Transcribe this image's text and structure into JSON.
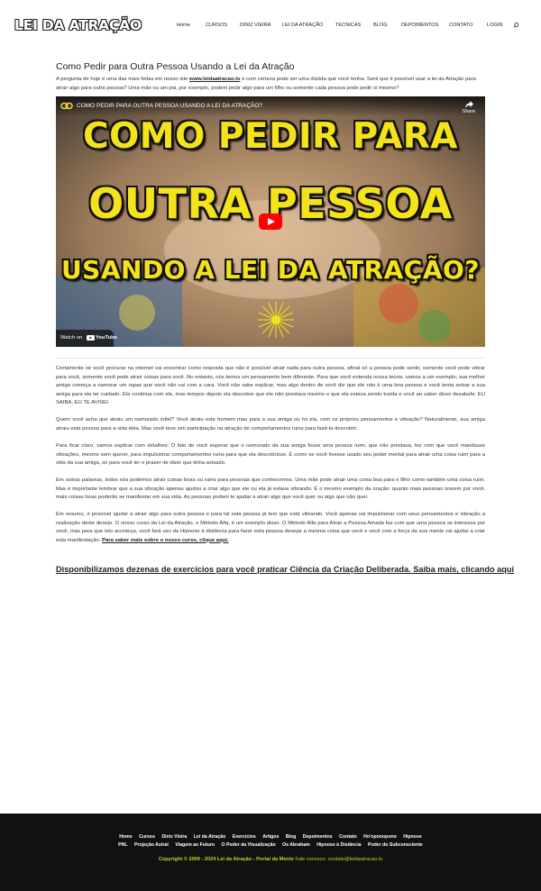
{
  "header": {
    "logo": "LEI DA ATRAÇÃO",
    "nav": [
      "Home",
      "CURSOS",
      "DINIZ VIEIRA",
      "LEI DA ATRAÇÃO",
      "TECNICAS",
      "BLOG",
      "DEPOIMENTOS",
      "CONTATO",
      "LOGIN"
    ],
    "search_icon": "search-icon"
  },
  "article": {
    "title": "Como Pedir para Outra Pessoa Usando a Lei da Atração",
    "intro_before": "A pergunta de hoje é uma das mais feitas em nosso site ",
    "intro_link": "www.leidaatracao.tv",
    "intro_after": " e com certeza pode ser uma dúvida que você tenha: Será que é possível usar a lei da Atração para atrair algo para outra pessoa? Uma mãe ou um pai, por exemplo, podem pedir algo para um filho ou somente cada pessoa pode pedir si mesmo?",
    "video": {
      "title": "COMO PEDIR PARA OUTRA PESSOA USANDO A LEI DA ATRAÇÃO?",
      "share_label": "Share",
      "thumb_line1": "COMO PEDIR PARA",
      "thumb_line2": "OUTRA PESSOA",
      "thumb_line3": "USANDO A LEI DA ATRAÇÃO?",
      "watch_on": "Watch on",
      "youtube": "YouTube"
    },
    "paragraphs": [
      "Certamente se você procurar na internet vai encontrar como resposta que não é possível atrair nada para outra pessoa, afinal só a pessoa pode sentir, somente você pode vibrar para você, somente você pode atrair coisas para você. No entanto, nós temos um pensamento bem diferente. Para que você entenda nossa teoria, vamos a um exemplo; sua melhor amiga começa a namorar um rapaz que você não vai com a cara. Você não sabe explicar, mas algo dentro de você diz que ele não é uma boa pessoa e você tenta avisar a sua amiga para ela ter cuidado. Ela continua com ele, mas tempos depois ela descobre que ele não prestava mesmo e que ela estava sendo traída e você ao saber disso desabafa: EU SAIBA, EU TE AVISEI.",
      "Quem você acha que atraiu um namorado infiel? Você atraiu este homem mau para a sua amiga ou foi ela, com os próprios pensamentos e vibração? Naturalmente, sua amiga atraiu esta pessoa para a vida dela. Mas você teve sim participação na atração de comportamentos ruins para fazê-la descobrir.",
      "Para ficar claro, vamos explicar com detalhes: O fato de você esperar que o namorado da sua amiga fosse uma pessoa ruim, que não prestava, fez com que você mandasse vibrações, mesmo sem querer, para impulsionar comportamentos ruins para que ela descobrisse. É como se você tivesse usado seu poder mental para atrair uma coisa ruim para a vida da sua amiga, só para você ter o prazer de dizer que tinha avisado.",
      "Em outras palavras, todos nós podemos atrair coisas boas ou ruins para pessoas que conhecemos. Uma mãe pode atrair uma coisa boa para o filho como também uma coisa ruim. Mas é importante lembrar que a sua vibração apenas ajudou a criar algo que ele ou ela já estava vibrando. É o mesmo exemplo da oração: quanto mais pessoas orarem por você, mais coisas boas poderão se manifestar em sua vida. As pessoas podem te ajudar a atrair algo que você quer ou algo que não quer.",
      "Em resumo, é possível ajudar a atrair algo para outra pessoa e para tal esta pessoa já tem que está vibrando. Você apenas vai impulsionar com seus pensamentos e vibração a realização deste desejo. O nosso curso da Lei da Atração, o Método Alfa, é um exemplo disso. O Método Alfa para Atrair a Pessoa Amada faz com que uma pessoa se interesse por você, mas para que isto aconteça, você fará uso da Hipnose à distância para fazer esta pessoa desejar a mesma coisa que você e você com a força da sua mente vai ajudar a criar esta manifestação. "
    ],
    "last_link": "Para saber mais sobre o nosso curso, clique aqui.",
    "cta": "Disponibilizamos dezenas de exercícios para você praticar Ciência da Criação Deliberada. Saiba mais, clicando aqui"
  },
  "footer": {
    "row1": [
      "Home",
      "Cursos",
      "Diniz Vieira",
      "Lei da Atração",
      "Exercícios",
      "Artigos",
      "Blog",
      "Depoimentos",
      "Contato",
      "Ho'oponopono",
      "Hipnose"
    ],
    "row2": [
      "PNL",
      "Projeção Astral",
      "Viagem ao Futuro",
      "O Poder da Visualização",
      "Os Abraham",
      "Hipnose à Distância",
      "Poder do Subconsciente"
    ],
    "copyright": "Copyright © 2009 - 2024 Lei da Atração - Portal da Mente",
    "contact": " Fale conosco: contato@leidaatracao.tv"
  },
  "colors": {
    "thumb_text": "#f4e21a",
    "footer_bg": "#111113",
    "copyright": "#c8d21c",
    "play_red": "#ff0000"
  }
}
